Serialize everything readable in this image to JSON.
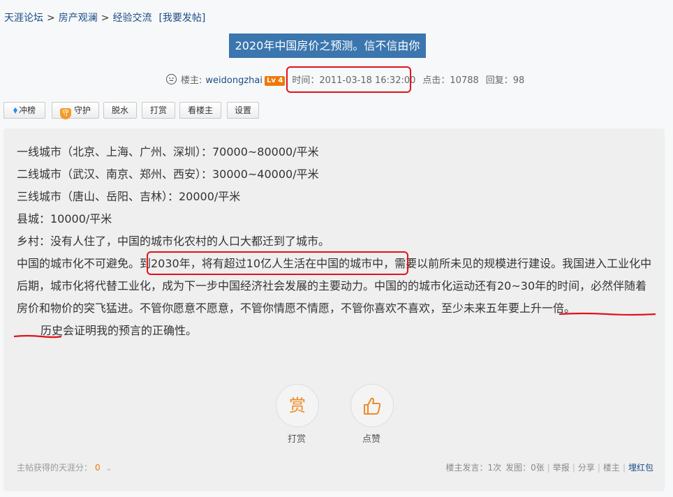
{
  "breadcrumb": {
    "forum": "天涯论坛",
    "sep1": ">",
    "board": "房产观澜",
    "sep2": ">",
    "section": "经验交流",
    "post_link": "[我要发帖]"
  },
  "post": {
    "title": "2020年中国房价之预测。信不信由你",
    "author_label": "楼主:",
    "author": "weidongzhai",
    "level": "Lv 4",
    "time": "时间：2011-03-18 16:32:00",
    "clicks": "点击：10788",
    "replies": "回复：98"
  },
  "toolbar": {
    "rank": "冲榜",
    "guard_icon_char": "守",
    "guard": "守护",
    "dehydrate": "脱水",
    "tip": "打赏",
    "view_op": "看楼主",
    "settings": "设置"
  },
  "content": {
    "line1": "一线城市（北京、上海、广州、深圳）：70000~80000/平米",
    "line2": "二线城市（武汉、南京、郑州、西安）：30000~40000/平米",
    "line3": "三线城市（唐山、岳阳、吉林）：20000/平米",
    "line4": "县城：10000/平米",
    "line5": "乡村：没有人住了，中国的城市化农村的人口大都迁到了城市。",
    "line6": "中国的城市化不可避免。到2030年，将有超过10亿人生活在中国的城市中，需要以前所未见的规模进行建设。我国进入工业化中后期，城市化将代替工业化，成为下一步中国经济社会发展的主要动力。中国的的城市化运动还有20~30年的时间，必然伴随着房价和物价的突飞猛进。不管你愿意不愿意，不管你情愿不情愿，不管你喜欢不喜欢，至少未来五年要上升一倍。",
    "line7": "历史会证明我的预言的正确性。"
  },
  "actions": {
    "tip_icon_char": "赏",
    "tip_label": "打赏",
    "like_label": "点赞"
  },
  "footer": {
    "score_label": "主帖获得的天涯分：",
    "score": "0",
    "op_posts": "楼主发言：1次",
    "images": "发图：0张",
    "report": "举报",
    "share": "分享",
    "op": "楼主",
    "redpacket": "埋红包"
  },
  "colors": {
    "link": "#1a4d86",
    "title_bg": "#3b76ae",
    "highlight_red": "#e1121b",
    "accent_orange": "#f0780a"
  }
}
